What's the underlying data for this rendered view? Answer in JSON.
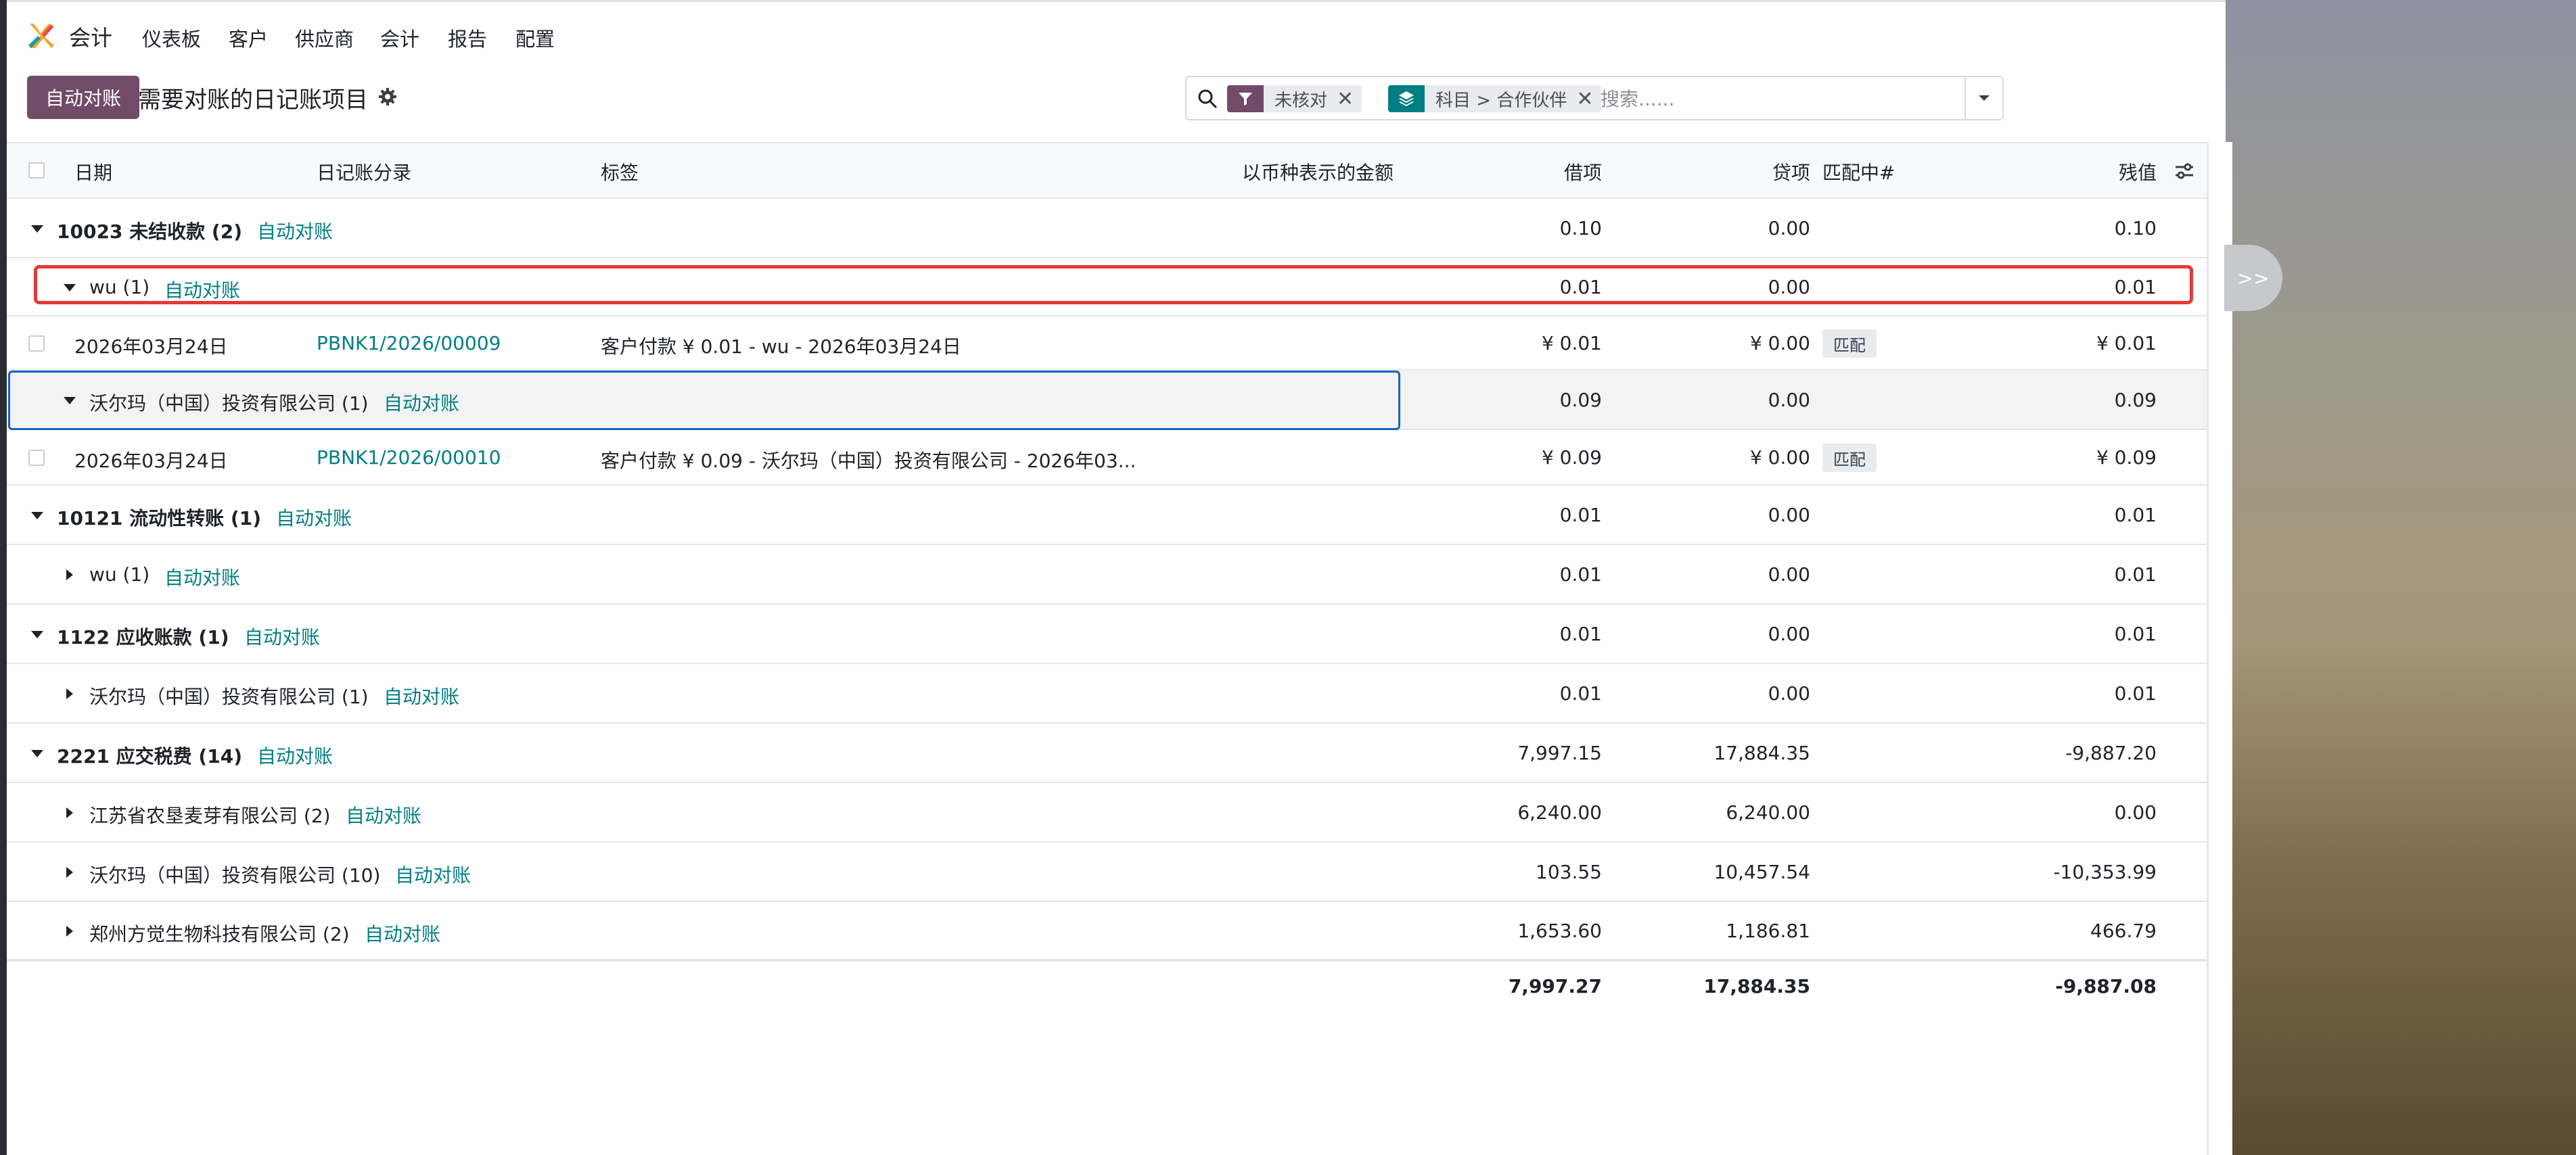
{
  "app": {
    "name": "会计"
  },
  "nav": [
    "仪表板",
    "客户",
    "供应商",
    "会计",
    "报告",
    "配置"
  ],
  "control_panel": {
    "auto_reconcile_label": "自动对账",
    "title": "需要对账的日记账项目"
  },
  "search": {
    "facets": [
      {
        "label": "未核对",
        "icon": "filter-icon",
        "color": "#714b67"
      },
      {
        "label": "科目 > 合作伙伴",
        "icon": "layers-icon",
        "color": "#017e84"
      }
    ],
    "placeholder": "搜索......"
  },
  "columns": {
    "date": "日期",
    "entry": "日记账分录",
    "label": "标签",
    "amount_currency": "以币种表示的金额",
    "debit": "借项",
    "credit": "贷项",
    "matching": "匹配中#",
    "balance": "残值"
  },
  "rows": [
    {
      "type": "group",
      "level": 1,
      "expanded": true,
      "name": "10023 未结收款 (2)",
      "action": "自动对账",
      "debit": "0.10",
      "credit": "0.00",
      "balance": "0.10"
    },
    {
      "type": "group",
      "level": 2,
      "expanded": true,
      "name": "wu (1)",
      "action": "自动对账",
      "debit": "0.01",
      "credit": "0.00",
      "balance": "0.01"
    },
    {
      "type": "record",
      "date": "2026年03月24日",
      "entry": "PBNK1/2026/00009",
      "label": "客户付款 ¥ 0.01 - wu - 2026年03月24日",
      "debit": "¥ 0.01",
      "credit": "¥ 0.00",
      "matching": "匹配",
      "balance": "¥ 0.01"
    },
    {
      "type": "group",
      "level": 2,
      "expanded": true,
      "name": "沃尔玛（中国）投资有限公司 (1)",
      "action": "自动对账",
      "debit": "0.09",
      "credit": "0.00",
      "balance": "0.09"
    },
    {
      "type": "record",
      "date": "2026年03月24日",
      "entry": "PBNK1/2026/00010",
      "label": "客户付款 ¥ 0.09 - 沃尔玛（中国）投资有限公司 - 2026年03...",
      "debit": "¥ 0.09",
      "credit": "¥ 0.00",
      "matching": "匹配",
      "balance": "¥ 0.09"
    },
    {
      "type": "group",
      "level": 1,
      "expanded": true,
      "name": "10121 流动性转账 (1)",
      "action": "自动对账",
      "debit": "0.01",
      "credit": "0.00",
      "balance": "0.01"
    },
    {
      "type": "group",
      "level": 2,
      "expanded": false,
      "name": "wu (1)",
      "action": "自动对账",
      "debit": "0.01",
      "credit": "0.00",
      "balance": "0.01"
    },
    {
      "type": "group",
      "level": 1,
      "expanded": true,
      "name": "1122 应收账款 (1)",
      "action": "自动对账",
      "debit": "0.01",
      "credit": "0.00",
      "balance": "0.01"
    },
    {
      "type": "group",
      "level": 2,
      "expanded": false,
      "name": "沃尔玛（中国）投资有限公司 (1)",
      "action": "自动对账",
      "debit": "0.01",
      "credit": "0.00",
      "balance": "0.01"
    },
    {
      "type": "group",
      "level": 1,
      "expanded": true,
      "name": "2221 应交税费 (14)",
      "action": "自动对账",
      "debit": "7,997.15",
      "credit": "17,884.35",
      "balance": "-9,887.20"
    },
    {
      "type": "group",
      "level": 2,
      "expanded": false,
      "name": "江苏省农垦麦芽有限公司 (2)",
      "action": "自动对账",
      "debit": "6,240.00",
      "credit": "6,240.00",
      "balance": "0.00"
    },
    {
      "type": "group",
      "level": 2,
      "expanded": false,
      "name": "沃尔玛（中国）投资有限公司 (10)",
      "action": "自动对账",
      "debit": "103.55",
      "credit": "10,457.54",
      "balance": "-10,353.99"
    },
    {
      "type": "group",
      "level": 2,
      "expanded": false,
      "name": "郑州方觉生物科技有限公司 (2)",
      "action": "自动对账",
      "debit": "1,653.60",
      "credit": "1,186.81",
      "balance": "466.79"
    }
  ],
  "totals": {
    "debit": "7,997.27",
    "credit": "17,884.35",
    "balance": "-9,887.08"
  },
  "side_toggle": ">>"
}
